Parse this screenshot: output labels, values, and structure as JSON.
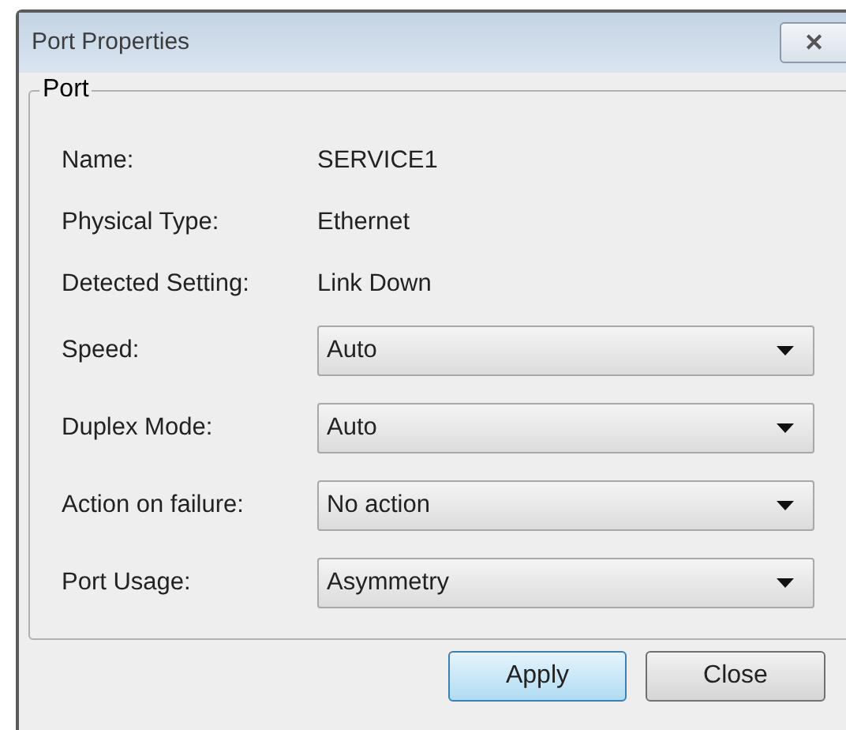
{
  "window": {
    "title": "Port Properties",
    "close_glyph": "✕"
  },
  "group": {
    "title": "Port",
    "info": [
      {
        "label": "Name:",
        "value": "SERVICE1"
      },
      {
        "label": "Physical Type:",
        "value": "Ethernet"
      },
      {
        "label": "Detected Setting:",
        "value": "Link Down"
      }
    ],
    "selects": [
      {
        "label": "Speed:",
        "value": "Auto"
      },
      {
        "label": "Duplex Mode:",
        "value": "Auto"
      },
      {
        "label": "Action on failure:",
        "value": "No action"
      },
      {
        "label": "Port Usage:",
        "value": "Asymmetry"
      }
    ]
  },
  "buttons": [
    {
      "label": "Apply",
      "default": true
    },
    {
      "label": "Close",
      "default": false
    }
  ]
}
